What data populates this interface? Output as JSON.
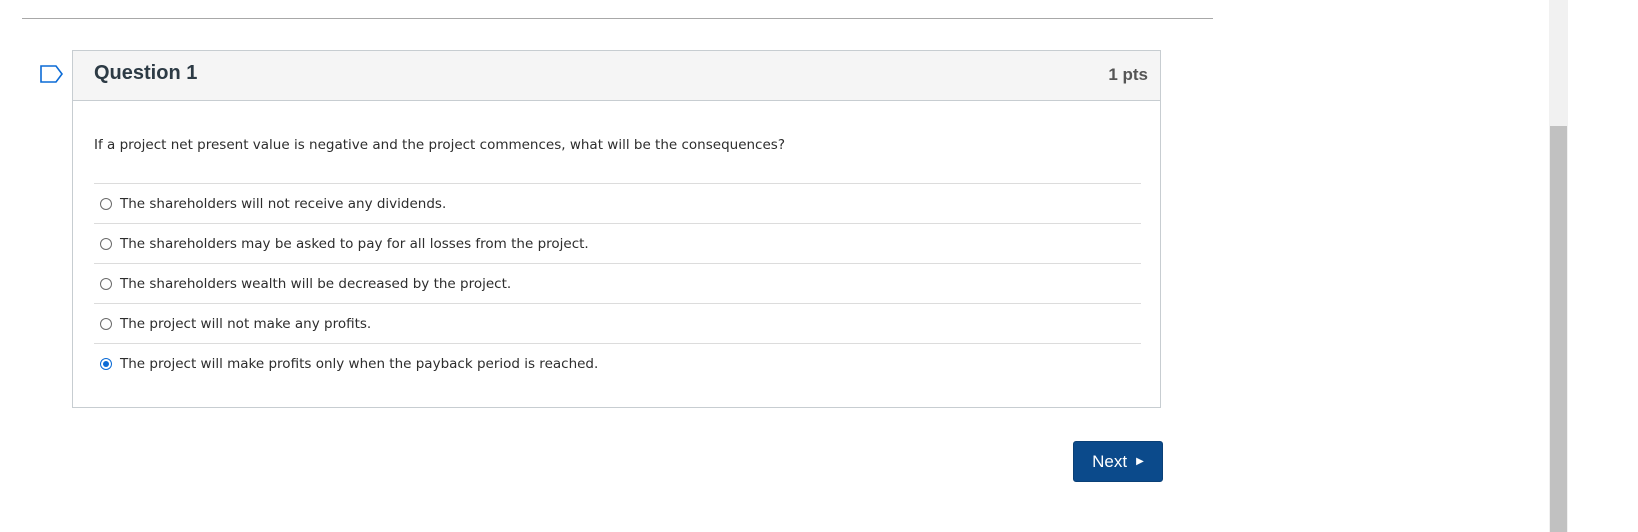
{
  "question": {
    "title": "Question 1",
    "points": "1 pts",
    "text": "If a project net present value is negative and the project commences, what will be the consequences?",
    "flag_icon": "bookmark-flag-icon",
    "answers": [
      {
        "label": "The shareholders will not receive any dividends.",
        "selected": false
      },
      {
        "label": "The shareholders may be asked to pay for all losses from the project.",
        "selected": false
      },
      {
        "label": "The shareholders wealth will be decreased by the project.",
        "selected": false
      },
      {
        "label": "The project will not make any profits.",
        "selected": false
      },
      {
        "label": "The project will make profits only when the payback period is reached.",
        "selected": true
      }
    ]
  },
  "navigation": {
    "next_label": "Next",
    "next_icon": "caret-right-icon"
  },
  "colors": {
    "button_bg": "#0b4a8b",
    "radio_selected": "#0b6bd6",
    "header_bg": "#f5f5f5"
  }
}
